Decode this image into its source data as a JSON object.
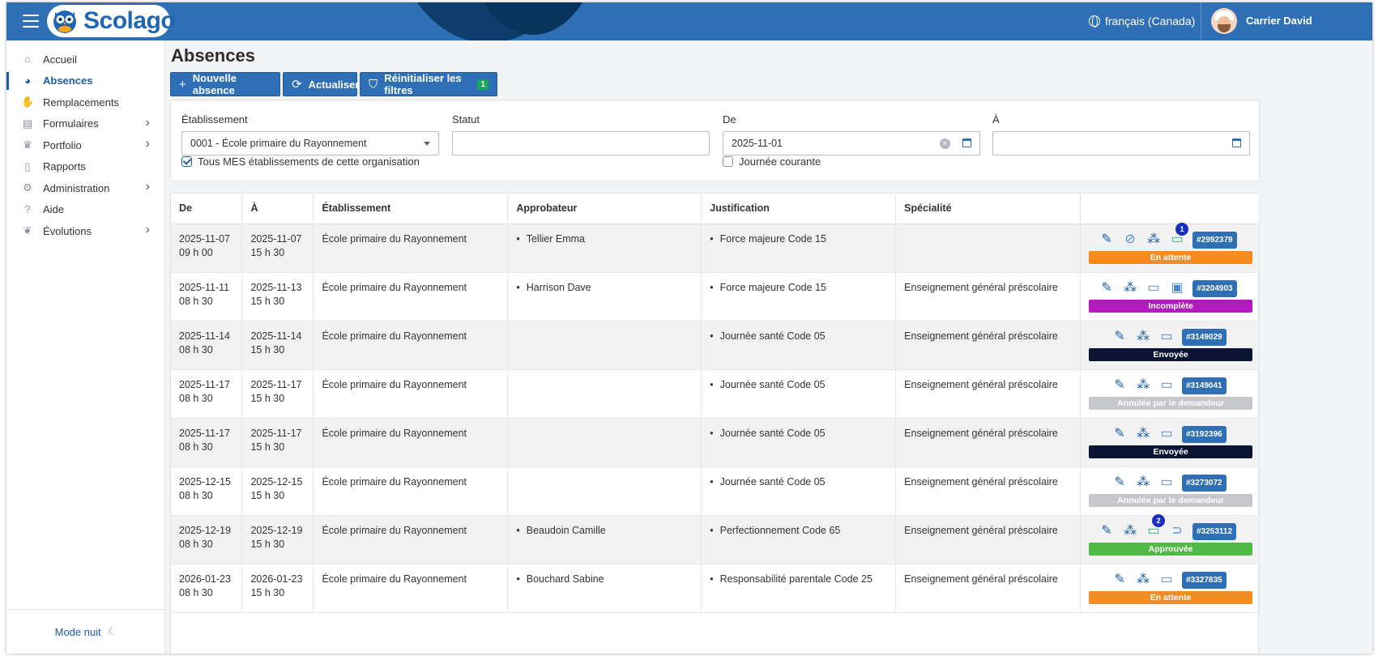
{
  "app": {
    "logo_text": "Scolago"
  },
  "header": {
    "language": "français (Canada)",
    "user_name": "Carrier David"
  },
  "sidebar": {
    "items": [
      {
        "label": "Accueil",
        "icon": "home-icon",
        "has_children": false,
        "active": false
      },
      {
        "label": "Absences",
        "icon": "user-clock-icon",
        "has_children": false,
        "active": true
      },
      {
        "label": "Remplacements",
        "icon": "handshake-icon",
        "has_children": false,
        "active": false
      },
      {
        "label": "Formulaires",
        "icon": "form-icon",
        "has_children": true,
        "active": false
      },
      {
        "label": "Portfolio",
        "icon": "trophy-icon",
        "has_children": true,
        "active": false
      },
      {
        "label": "Rapports",
        "icon": "report-icon",
        "has_children": false,
        "active": false
      },
      {
        "label": "Administration",
        "icon": "gear-icon",
        "has_children": true,
        "active": false
      },
      {
        "label": "Aide",
        "icon": "question-icon",
        "has_children": false,
        "active": false
      },
      {
        "label": "Évolutions",
        "icon": "sprout-icon",
        "has_children": true,
        "active": false
      }
    ],
    "mode_nuit": "Mode nuit"
  },
  "page": {
    "title": "Absences",
    "buttons": {
      "new_absence": "Nouvelle absence",
      "refresh": "Actualiser",
      "reset_filters": "Réinitialiser les filtres",
      "reset_filters_count": "1"
    }
  },
  "filters": {
    "etablissement_label": "Établissement",
    "etablissement_value": "0001 - École primaire du Rayonnement",
    "etablissement_checkbox": "Tous MES établissements de cette organisation",
    "statut_label": "Statut",
    "statut_value": "",
    "de_label": "De",
    "de_value": "2025-11-01",
    "journee_courante": "Journée courante",
    "a_label": "À",
    "a_value": ""
  },
  "table": {
    "headers": [
      "De",
      "À",
      "Établissement",
      "Approbateur",
      "Justification",
      "Spécialité",
      ""
    ],
    "rows": [
      {
        "de_date": "2025-11-07",
        "de_time": "09 h 00",
        "a_date": "2025-11-07",
        "a_time": "15 h 30",
        "etablissement": "École primaire du Rayonnement",
        "approbateur": "Tellier Emma",
        "justification": "Force majeure Code 15",
        "specialite": "",
        "id": "#2992379",
        "status": "En attente",
        "status_color": "#f68b1f",
        "chat_count": "1",
        "chat_green": true,
        "icons": [
          "edit",
          "no-user",
          "workflow",
          "chat"
        ]
      },
      {
        "de_date": "2025-11-11",
        "de_time": "08 h 30",
        "a_date": "2025-11-13",
        "a_time": "15 h 30",
        "etablissement": "École primaire du Rayonnement",
        "approbateur": "Harrison Dave",
        "justification": "Force majeure Code 15",
        "specialite": "Enseignement général préscolaire",
        "id": "#3204903",
        "status": "Incomplète",
        "status_color": "#b41ac0",
        "chat_count": "",
        "chat_green": false,
        "icons": [
          "edit",
          "workflow",
          "chat",
          "image"
        ]
      },
      {
        "de_date": "2025-11-14",
        "de_time": "08 h 30",
        "a_date": "2025-11-14",
        "a_time": "15 h 30",
        "etablissement": "École primaire du Rayonnement",
        "approbateur": "",
        "justification": "Journée santé Code 05",
        "specialite": "Enseignement général préscolaire",
        "id": "#3149029",
        "status": "Envoyée",
        "status_color": "#0b1533",
        "chat_count": "",
        "chat_green": false,
        "icons": [
          "edit",
          "workflow",
          "chat"
        ]
      },
      {
        "de_date": "2025-11-17",
        "de_time": "08 h 30",
        "a_date": "2025-11-17",
        "a_time": "15 h 30",
        "etablissement": "École primaire du Rayonnement",
        "approbateur": "",
        "justification": "Journée santé Code 05",
        "specialite": "Enseignement général préscolaire",
        "id": "#3149041",
        "status": "Annulée par le demandeur",
        "status_color": "#c5c7ca",
        "chat_count": "",
        "chat_green": false,
        "icons": [
          "edit",
          "workflow",
          "chat"
        ]
      },
      {
        "de_date": "2025-11-17",
        "de_time": "08 h 30",
        "a_date": "2025-11-17",
        "a_time": "15 h 30",
        "etablissement": "École primaire du Rayonnement",
        "approbateur": "",
        "justification": "Journée santé Code 05",
        "specialite": "Enseignement général préscolaire",
        "id": "#3192396",
        "status": "Envoyée",
        "status_color": "#0b1533",
        "chat_count": "",
        "chat_green": false,
        "icons": [
          "edit",
          "workflow",
          "chat"
        ]
      },
      {
        "de_date": "2025-12-15",
        "de_time": "08 h 30",
        "a_date": "2025-12-15",
        "a_time": "15 h 30",
        "etablissement": "École primaire du Rayonnement",
        "approbateur": "",
        "justification": "Journée santé Code 05",
        "specialite": "Enseignement général préscolaire",
        "id": "#3273072",
        "status": "Annulée par le demandeur",
        "status_color": "#c5c7ca",
        "chat_count": "",
        "chat_green": false,
        "icons": [
          "edit",
          "workflow",
          "chat"
        ]
      },
      {
        "de_date": "2025-12-19",
        "de_time": "08 h 30",
        "a_date": "2025-12-19",
        "a_time": "15 h 30",
        "etablissement": "École primaire du Rayonnement",
        "approbateur": "Beaudoin Camille",
        "justification": "Perfectionnement Code 65",
        "specialite": "Enseignement général préscolaire",
        "id": "#3253112",
        "status": "Approuvée",
        "status_color": "#52b947",
        "chat_count": "2",
        "chat_green": true,
        "icons": [
          "edit",
          "workflow",
          "chat",
          "attachment"
        ]
      },
      {
        "de_date": "2026-01-23",
        "de_time": "08 h 30",
        "a_date": "2026-01-23",
        "a_time": "15 h 30",
        "etablissement": "École primaire du Rayonnement",
        "approbateur": "Bouchard Sabine",
        "justification": "Responsabilité parentale Code 25",
        "specialite": "Enseignement général préscolaire",
        "id": "#3327835",
        "status": "En attente",
        "status_color": "#f68b1f",
        "chat_count": "",
        "chat_green": false,
        "icons": [
          "edit",
          "workflow",
          "chat"
        ]
      }
    ]
  }
}
